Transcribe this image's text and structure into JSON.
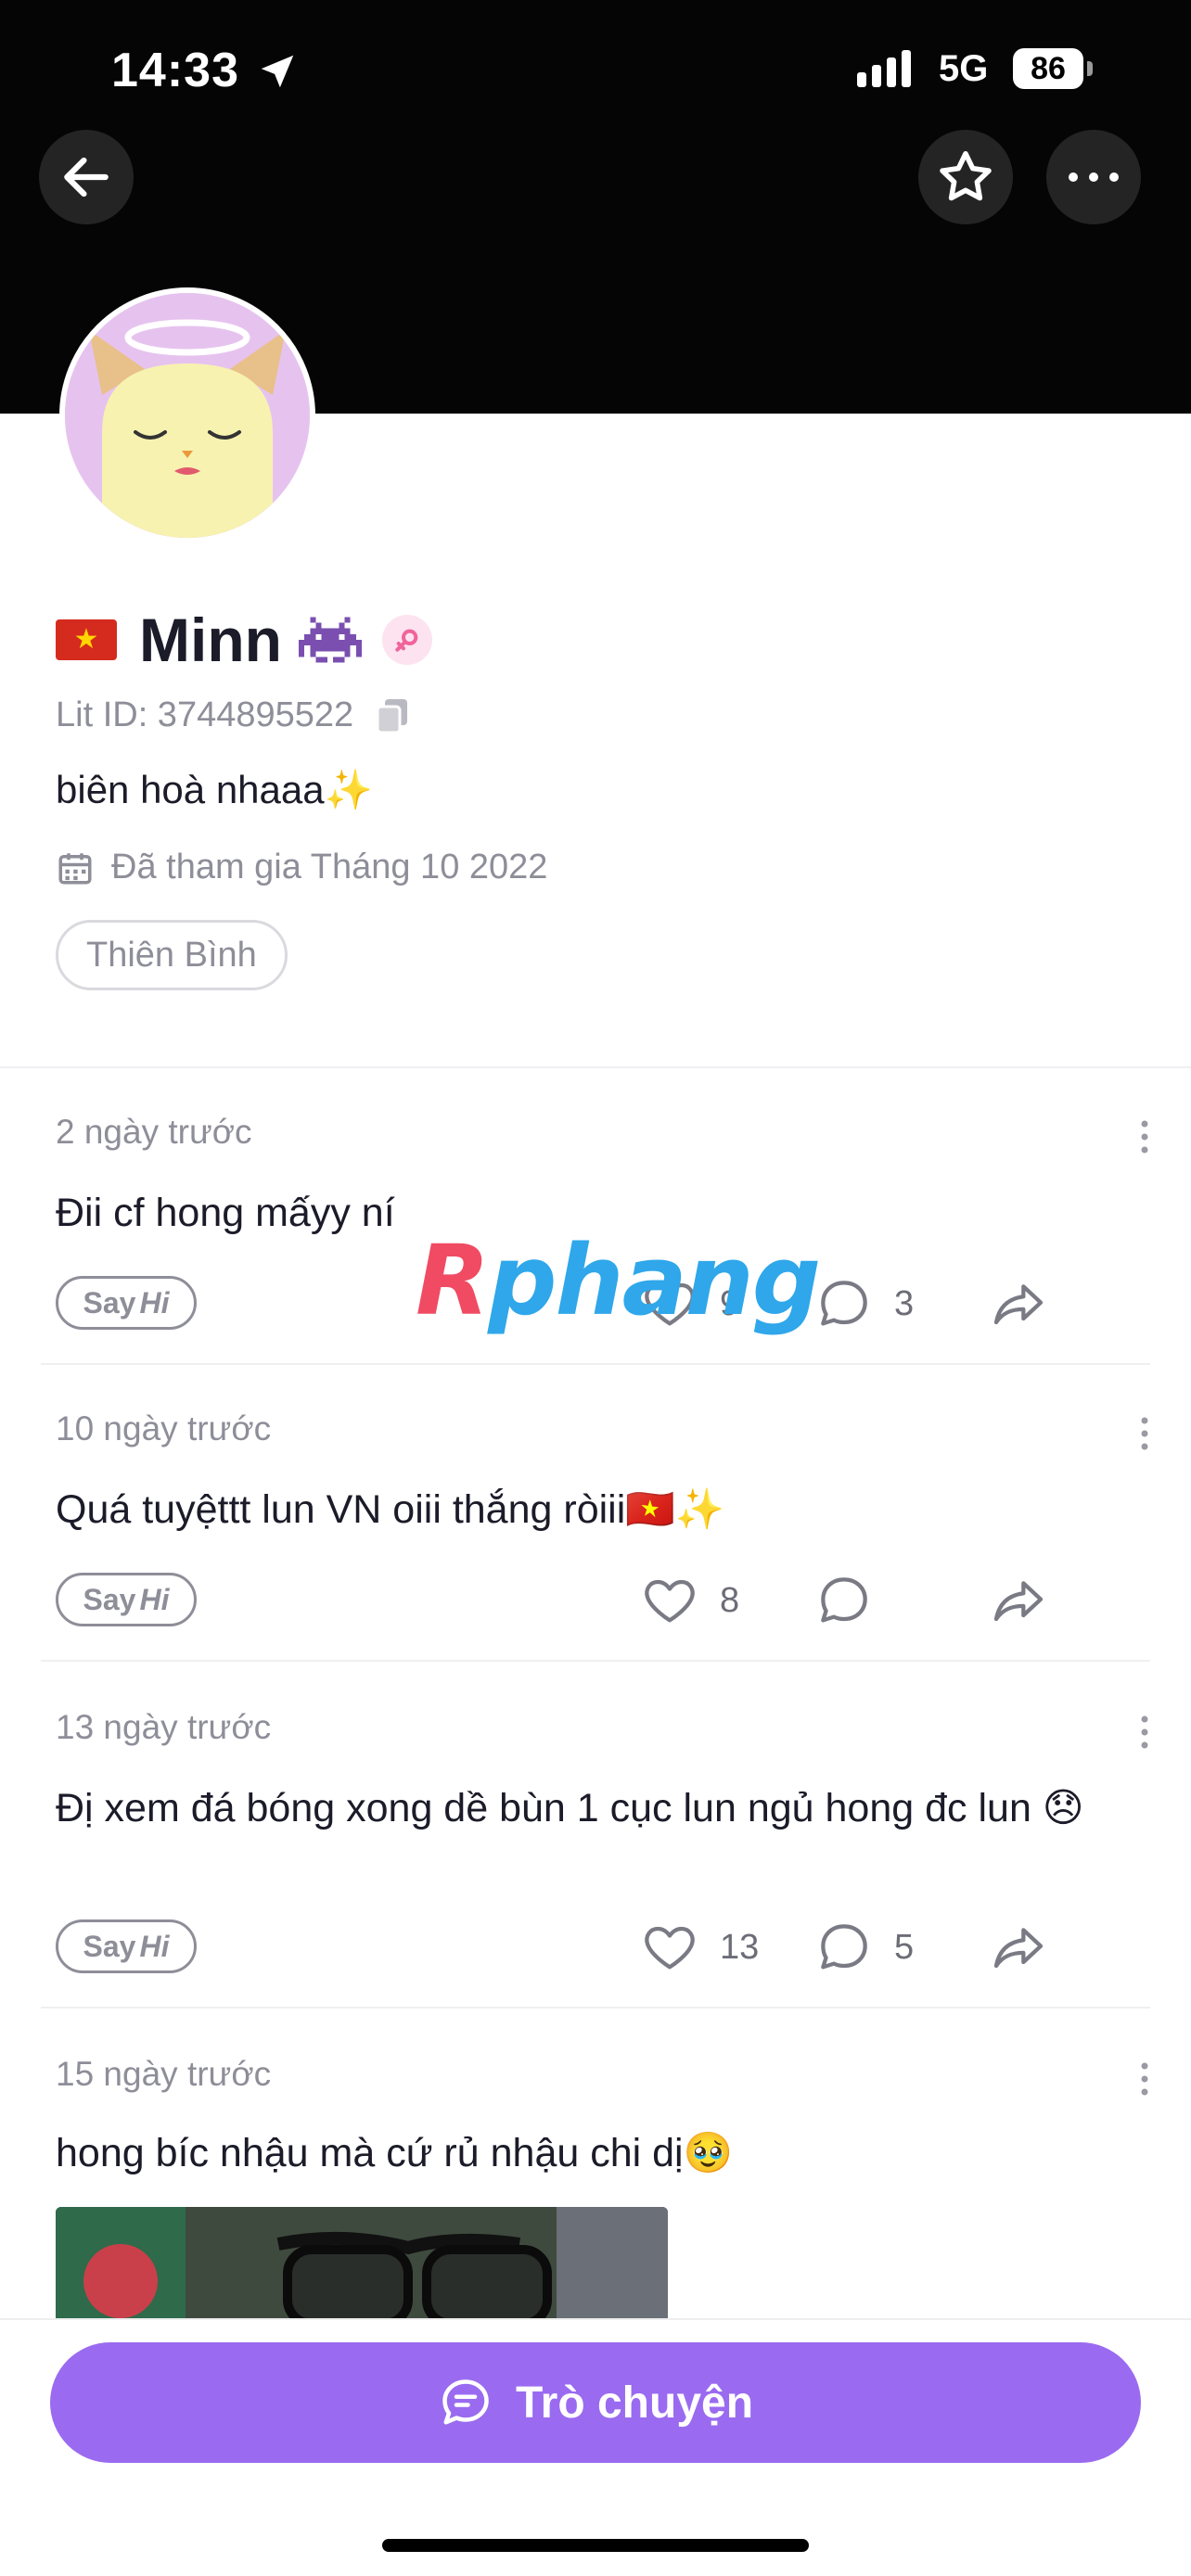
{
  "status_bar": {
    "time": "14:33",
    "network": "5G",
    "battery": "86"
  },
  "header": {
    "back_icon": "back-arrow-icon",
    "star_icon": "star-icon",
    "more_icon": "more-dots-icon"
  },
  "profile": {
    "name": "Minn",
    "lit_id": "Lit ID: 3744895522",
    "bio": "biên hoà nhaaa✨",
    "joined": "Đã tham gia Tháng 10 2022",
    "tag": "Thiên Bình"
  },
  "posts": [
    {
      "date": "2 ngày trước",
      "text": "Đii cf hong mấyy ní",
      "likes": "9",
      "comments": "3"
    },
    {
      "date": "10 ngày trước",
      "text": "Quá tuyệttt lun VN oiii thắng ròiii🇻🇳✨",
      "likes": "8",
      "comments": ""
    },
    {
      "date": "13 ngày trước",
      "text": "Đị xem đá bóng xong dề bùn 1 cục lun ngủ hong đc lun 😞",
      "likes": "13",
      "comments": "5"
    },
    {
      "date": "15 ngày trước",
      "text": "hong bíc nhậu mà cứ rủ nhậu chi dị🥹"
    }
  ],
  "sayhi": {
    "say": "Say",
    "hi": "Hi"
  },
  "watermark": {
    "part1": "R",
    "part2": "phang"
  },
  "chat_button": {
    "label": "Trò chuyện"
  },
  "colors": {
    "accent": "#9a6bf0",
    "header_bg": "#050505",
    "avatar_bg": "#e6c3ef"
  }
}
